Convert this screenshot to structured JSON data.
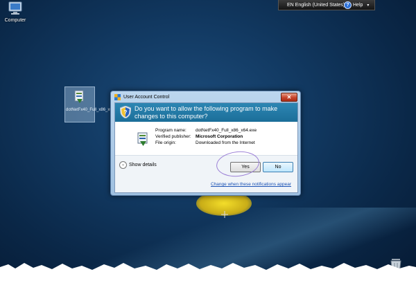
{
  "desktop": {
    "computer_icon_label": "Computer",
    "setup_icon_label": "dotNetFx40_Full_x86_x64"
  },
  "langbar": {
    "language": "EN English (United States)",
    "help_label": "Help",
    "help_glyph": "?"
  },
  "uac": {
    "title": "User Account Control",
    "close_glyph": "✕",
    "question": "Do you want to allow the following program to make changes to this computer?",
    "fields": [
      {
        "key": "Program name:",
        "value": "dotNetFx40_Full_x86_x64.exe",
        "bold": false
      },
      {
        "key": "Verified publisher:",
        "value": "Microsoft Corporation",
        "bold": true
      },
      {
        "key": "File origin:",
        "value": "Downloaded from the Internet",
        "bold": false
      }
    ],
    "show_details_label": "Show details",
    "show_details_glyph": "⌄",
    "yes_label": "Yes",
    "no_label": "No",
    "settings_link": "Change when these notifications appear"
  },
  "colors": {
    "header_blue": "#1b6e99",
    "annotation_circle": "#9b7fd6",
    "link": "#1a52b5"
  }
}
